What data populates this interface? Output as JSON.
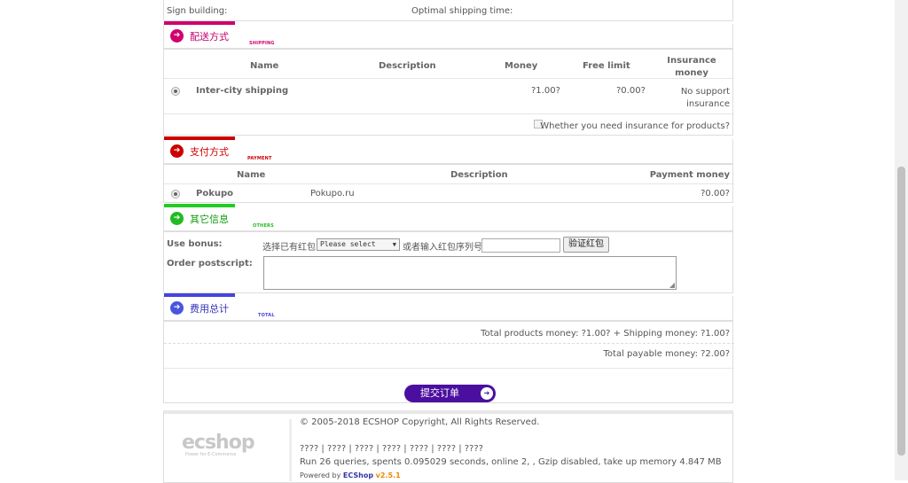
{
  "top_row": {
    "sign_building": "Sign building:",
    "optimal_time": "Optimal shipping time:"
  },
  "shipping": {
    "title": "配送方式",
    "subtitle": "SHIPPING",
    "accent": "#d0006f",
    "headers": {
      "name": "Name",
      "description": "Description",
      "money": "Money",
      "free_limit": "Free limit",
      "insurance": "Insurance money"
    },
    "row": {
      "name": "Inter-city shipping",
      "money": "?1.00?",
      "free_limit": "?0.00?",
      "insurance": "No support insurance"
    },
    "insure_label": "Whether you need insurance for products?"
  },
  "payment": {
    "title": "支付方式",
    "subtitle": "PAYMENT",
    "accent": "#cc0000",
    "headers": {
      "name": "Name",
      "description": "Description",
      "payment_money": "Payment money"
    },
    "row": {
      "name": "Pokupo",
      "description": "Pokupo.ru",
      "money": "?0.00?"
    }
  },
  "others": {
    "title": "其它信息",
    "subtitle": "OTHERS",
    "accent": "#22cc22",
    "bonus_label": "Use bonus:",
    "select_existing": "选择已有红包",
    "select_value": "Please select",
    "or_enter": "或者输入红包序列号",
    "verify_button": "验证红包",
    "postscript_label": "Order postscript:"
  },
  "total": {
    "title": "费用总计",
    "subtitle": "TOTAL",
    "accent": "#4444dd",
    "line1": "Total products money: ?1.00? + Shipping money: ?1.00?",
    "line2": "Total payable money: ?2.00?"
  },
  "submit": {
    "label": "提交订单",
    "color": "#4b0fa0"
  },
  "footer": {
    "copyright": "© 2005-2018 ECSHOP Copyright, All Rights Reserved.",
    "links": "???? | ???? | ???? | ???? | ???? | ???? | ????",
    "stats": "Run 26 queries, spents 0.095029 seconds, online 2, , Gzip disabled, take up memory 4.847 MB",
    "powered_by": "Powered by",
    "brand": "ECShop",
    "version": "v2.5.1",
    "logo_text": "ecshop",
    "logo_tagline": "Power for E-Commerce"
  }
}
